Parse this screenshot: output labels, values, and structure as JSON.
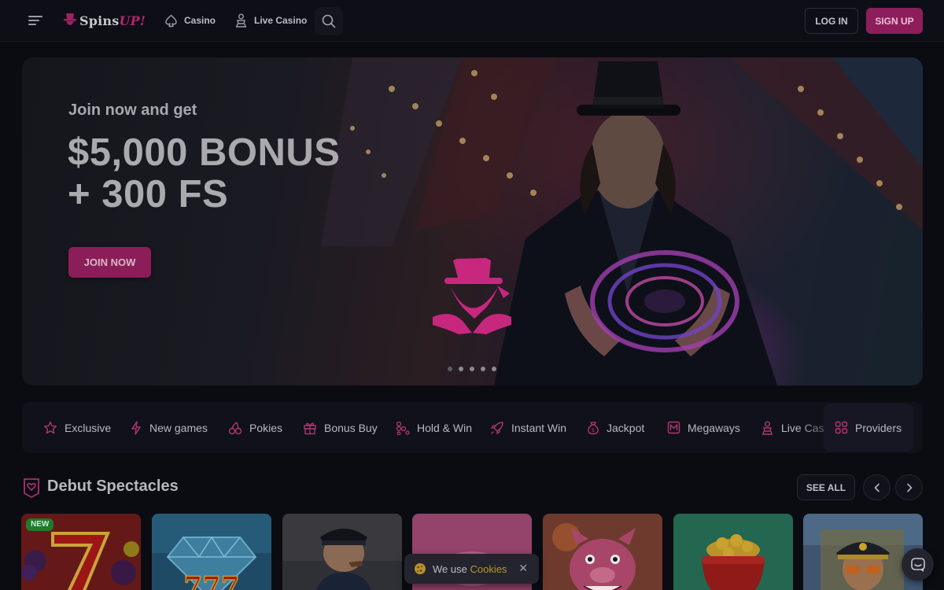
{
  "header": {
    "logo_text_a": "Spins",
    "logo_text_b": "UP!",
    "nav": [
      {
        "label": "Casino",
        "icon": "spade-icon"
      },
      {
        "label": "Live Casino",
        "icon": "dealer-icon"
      }
    ],
    "login_label": "LOG IN",
    "signup_label": "SIGN UP"
  },
  "hero": {
    "subtitle": "Join now and get",
    "title_line1": "$5,000 BONUS",
    "title_line2": "+ 300 FS",
    "cta_label": "JOIN NOW",
    "slides_count": 5,
    "active_slide": 1
  },
  "categories": [
    {
      "label": "Exclusive",
      "icon": "star-icon"
    },
    {
      "label": "New games",
      "icon": "lightning-icon"
    },
    {
      "label": "Pokies",
      "icon": "cherries-icon"
    },
    {
      "label": "Bonus Buy",
      "icon": "gift-icon"
    },
    {
      "label": "Hold & Win",
      "icon": "coins-icon"
    },
    {
      "label": "Instant Win",
      "icon": "rocket-icon"
    },
    {
      "label": "Jackpot",
      "icon": "money-bag-icon"
    },
    {
      "label": "Megaways",
      "icon": "megaways-icon"
    },
    {
      "label": "Live Casino",
      "icon": "dealer-icon"
    }
  ],
  "providers_label": "Providers",
  "section": {
    "title": "Debut Spectacles",
    "see_all_label": "SEE ALL"
  },
  "games": [
    {
      "badge": "NEW",
      "theme": "fruits-seven"
    },
    {
      "theme": "diamond-777"
    },
    {
      "theme": "sailor"
    },
    {
      "theme": "pink-candy"
    },
    {
      "theme": "pink-pig"
    },
    {
      "theme": "gold-pot"
    },
    {
      "theme": "pilot"
    }
  ],
  "cookie": {
    "text": "We use",
    "link": "Cookies",
    "close": "✕"
  },
  "colors": {
    "accent": "#8d1e5b",
    "background": "#0b0c12",
    "cookie_link": "#b69a2d"
  }
}
